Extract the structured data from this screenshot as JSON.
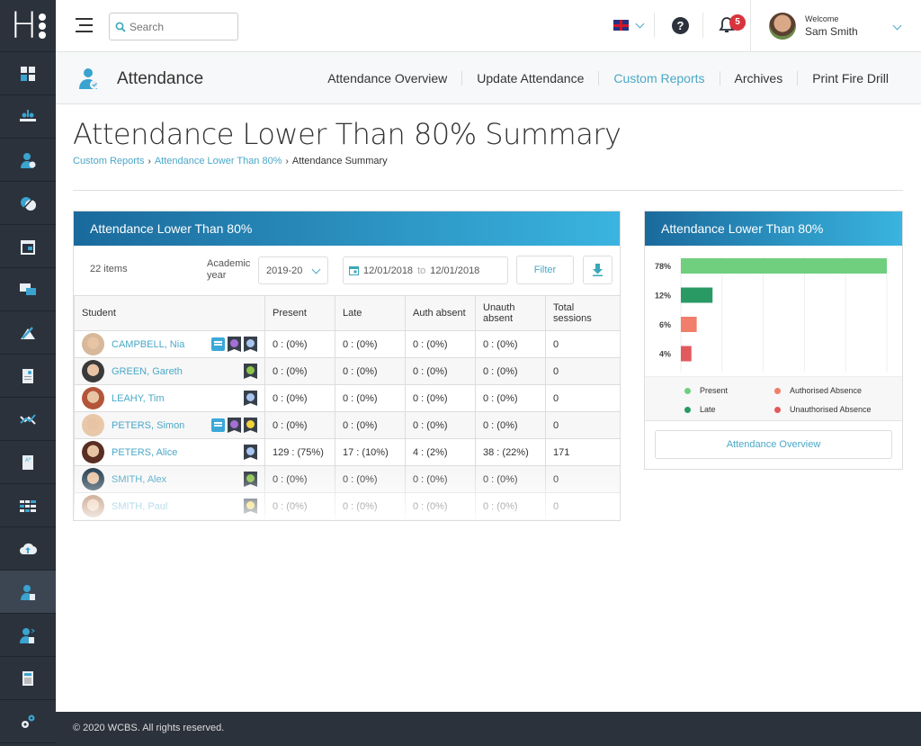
{
  "app": {
    "logo": "H"
  },
  "topbar": {
    "search_placeholder": "Search",
    "notifications_count": "5",
    "welcome": "Welcome",
    "user_name": "Sam Smith"
  },
  "module": {
    "title": "Attendance",
    "nav": [
      {
        "label": "Attendance Overview",
        "active": false
      },
      {
        "label": "Update Attendance",
        "active": false
      },
      {
        "label": "Custom Reports",
        "active": true
      },
      {
        "label": "Archives",
        "active": false
      },
      {
        "label": "Print Fire Drill",
        "active": false
      }
    ]
  },
  "sidebar": {
    "items": [
      "dashboard",
      "classes",
      "attendance-students",
      "behaviour",
      "calendar",
      "messages",
      "assessment",
      "reports",
      "tracking",
      "grades",
      "timetable",
      "upload",
      "attendance",
      "staff",
      "documents",
      "settings"
    ],
    "active_index": 12
  },
  "page": {
    "title": "Attendance Lower Than 80% Summary",
    "breadcrumb": [
      {
        "label": "Custom Reports",
        "link": true
      },
      {
        "label": "Attendance Lower Than 80%",
        "link": true
      },
      {
        "label": "Attendance Summary",
        "link": false
      }
    ]
  },
  "report": {
    "panel_title": "Attendance Lower Than 80%",
    "items_count": "22 items",
    "academic_year_label": "Academic year",
    "academic_year": "2019-20",
    "date_from": "12/01/2018",
    "date_to_label": "to",
    "date_to": "12/01/2018",
    "filter_label": "Filter",
    "columns": [
      "Student",
      "Present",
      "Late",
      "Auth absent",
      "Unauth absent",
      "Total sessions"
    ],
    "rows": [
      {
        "name": "CAMPBELL, Nia",
        "flags": [
          "msg",
          "#a56fd6",
          "#a8c4f0"
        ],
        "present": "0 : (0%)",
        "late": "0 : (0%)",
        "auth": "0 : (0%)",
        "unauth": "0 : (0%)",
        "total": "0",
        "avatar": "#d7b89a"
      },
      {
        "name": "GREEN, Gareth",
        "flags": [
          "#8bc34a"
        ],
        "present": "0 : (0%)",
        "late": "0 : (0%)",
        "auth": "0 : (0%)",
        "unauth": "0 : (0%)",
        "total": "0",
        "avatar": "#3a3a3a"
      },
      {
        "name": "LEAHY, Tim",
        "flags": [
          "#a8c4f0"
        ],
        "present": "0 : (0%)",
        "late": "0 : (0%)",
        "auth": "0 : (0%)",
        "unauth": "0 : (0%)",
        "total": "0",
        "avatar": "#b3553a"
      },
      {
        "name": "PETERS, Simon",
        "flags": [
          "msg",
          "#a56fd6",
          "#f2d33c"
        ],
        "present": "0 : (0%)",
        "late": "0 : (0%)",
        "auth": "0 : (0%)",
        "unauth": "0 : (0%)",
        "total": "0",
        "avatar": "#e8c8a8"
      },
      {
        "name": "PETERS, Alice",
        "flags": [
          "#a8c4f0"
        ],
        "present": "129 : (75%)",
        "late": "17 : (10%)",
        "auth": "4 : (2%)",
        "unauth": "38 : (22%)",
        "total": "171",
        "avatar": "#5a2e22"
      },
      {
        "name": "SMITH, Alex",
        "flags": [
          "#8bc34a"
        ],
        "present": "0 : (0%)",
        "late": "0 : (0%)",
        "auth": "0 : (0%)",
        "unauth": "0 : (0%)",
        "total": "0",
        "avatar": "#2f4a5a"
      },
      {
        "name": "SMITH, Paul",
        "flags": [
          "#f2d33c"
        ],
        "present": "0 : (0%)",
        "late": "0 : (0%)",
        "auth": "0 : (0%)",
        "unauth": "0 : (0%)",
        "total": "0",
        "avatar": "#b07a55"
      }
    ]
  },
  "side_panel": {
    "title": "Attendance Lower Than 80%",
    "button_label": "Attendance Overview"
  },
  "chart_data": {
    "type": "bar",
    "orientation": "horizontal",
    "title": "Attendance Lower Than 80%",
    "categories": [
      "Present",
      "Late",
      "Authorised Absence",
      "Unauthorised Absence"
    ],
    "tick_labels": [
      "78%",
      "12%",
      "6%",
      "4%"
    ],
    "values": [
      78,
      12,
      6,
      4
    ],
    "colors": [
      "#6fcf7f",
      "#2a9a64",
      "#f07e6a",
      "#e25a5e"
    ],
    "xlim": [
      0,
      78
    ],
    "grid": true,
    "legend": {
      "placement": "bottom",
      "entries": [
        {
          "label": "Present",
          "color": "#6fcf7f"
        },
        {
          "label": "Authorised Absence",
          "color": "#f07e6a"
        },
        {
          "label": "Late",
          "color": "#2a9a64"
        },
        {
          "label": "Unauthorised Absence",
          "color": "#e25a5e"
        }
      ]
    }
  },
  "footer": {
    "text": "© 2020 WCBS.  All rights reserved."
  },
  "colors": {
    "accent": "#4aa8c8",
    "sidebar": "#2b323c",
    "header_gradient_start": "#1a6a9c",
    "header_gradient_end": "#3ab4e0",
    "badge": "#d9343e"
  }
}
